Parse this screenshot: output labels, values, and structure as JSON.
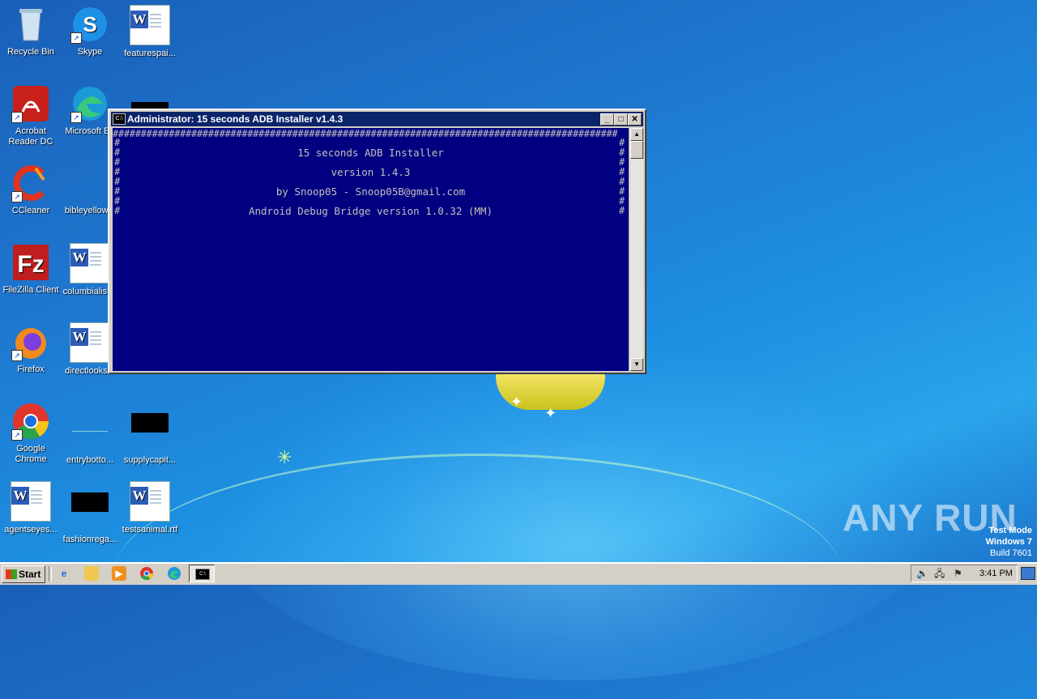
{
  "desktop": {
    "icons": [
      {
        "label": "Recycle Bin"
      },
      {
        "label": "Skype"
      },
      {
        "label": "featurespai..."
      },
      {
        "label_line1": "Acrobat",
        "label_line2": "Reader DC"
      },
      {
        "label": "Microsoft Ed"
      },
      {
        "label": "CCleaner"
      },
      {
        "label": "bibleyellow..."
      },
      {
        "label": "FileZilla Client"
      },
      {
        "label": "columbialist..."
      },
      {
        "label": "Firefox"
      },
      {
        "label": "directlooks..."
      },
      {
        "label_line1": "Google",
        "label_line2": "Chrome"
      },
      {
        "label": "entrybotto..."
      },
      {
        "label": "supplycapit..."
      },
      {
        "label": "agentseyes..."
      },
      {
        "label": "fashionrega..."
      },
      {
        "label": "testsanimal.rtf"
      }
    ]
  },
  "window": {
    "title": "Administrator:  15 seconds ADB Installer v1.4.3",
    "minimize": "_",
    "maximize": "□",
    "close": "✕",
    "icon_text": "C:\\",
    "console": {
      "border_char": "#",
      "lines": [
        "15 seconds ADB Installer",
        "version 1.4.3",
        "by Snoop05 - Snoop05B@gmail.com",
        "Android Debug Bridge version 1.0.32 (MM)"
      ]
    }
  },
  "watermark": {
    "brand": "ANY RUN",
    "test_mode": "Test Mode",
    "os": "Windows 7",
    "build": "Build 7601"
  },
  "taskbar": {
    "start_label": "Start",
    "clock": "3:41 PM"
  }
}
